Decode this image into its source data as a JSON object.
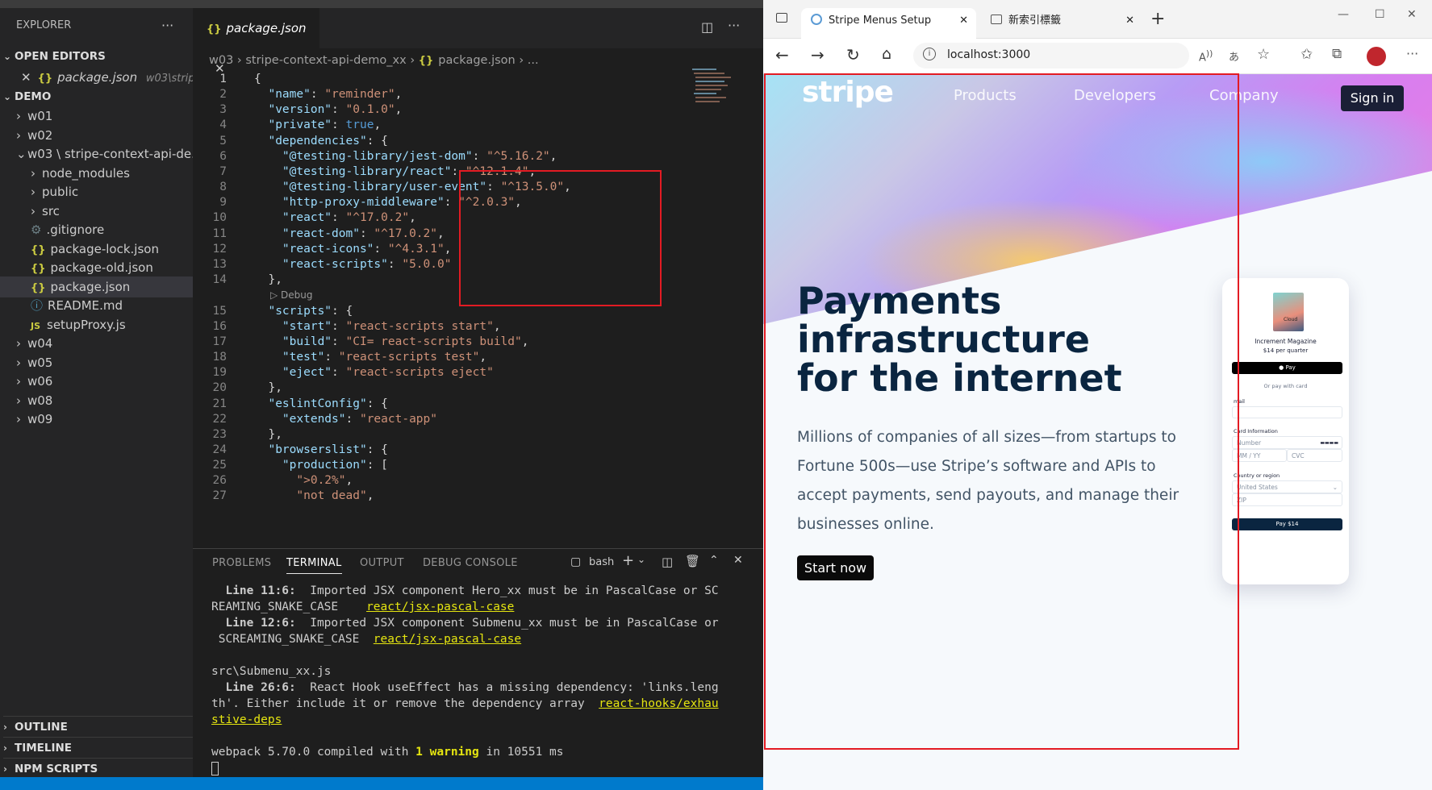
{
  "vscode": {
    "explorer_title": "EXPLORER",
    "open_editors_label": "OPEN EDITORS",
    "open_editor": {
      "name": "package.json",
      "path": "w03\\strip..."
    },
    "workspace_label": "DEMO",
    "tree": [
      {
        "name": "w01",
        "type": "folder"
      },
      {
        "name": "w02",
        "type": "folder"
      },
      {
        "name": "w03 \\ stripe-context-api-de...",
        "type": "folder-open"
      },
      {
        "name": "node_modules",
        "type": "folder",
        "indent": 1
      },
      {
        "name": "public",
        "type": "folder",
        "indent": 1
      },
      {
        "name": "src",
        "type": "folder",
        "indent": 1
      },
      {
        "name": ".gitignore",
        "type": "git",
        "indent": 1
      },
      {
        "name": "package-lock.json",
        "type": "json",
        "indent": 1
      },
      {
        "name": "package-old.json",
        "type": "json",
        "indent": 1
      },
      {
        "name": "package.json",
        "type": "json",
        "indent": 1,
        "selected": true
      },
      {
        "name": "README.md",
        "type": "info",
        "indent": 1
      },
      {
        "name": "setupProxy.js",
        "type": "js",
        "indent": 1
      },
      {
        "name": "w04",
        "type": "folder"
      },
      {
        "name": "w05",
        "type": "folder"
      },
      {
        "name": "w06",
        "type": "folder"
      },
      {
        "name": "w08",
        "type": "folder"
      },
      {
        "name": "w09",
        "type": "folder"
      }
    ],
    "bottom_sections": [
      "OUTLINE",
      "TIMELINE",
      "NPM SCRIPTS"
    ],
    "tab_label": "package.json",
    "breadcrumb": [
      "w03",
      "stripe-context-api-demo_xx",
      "package.json",
      "..."
    ],
    "debug_label": "Debug",
    "code_lines": [
      {
        "n": "1",
        "t": "{"
      },
      {
        "n": "2",
        "t": "  \"name\": \"reminder\","
      },
      {
        "n": "3",
        "t": "  \"version\": \"0.1.0\","
      },
      {
        "n": "4",
        "t": "  \"private\": true,"
      },
      {
        "n": "5",
        "t": "  \"dependencies\": {"
      },
      {
        "n": "6",
        "t": "    \"@testing-library/jest-dom\": \"^5.16.2\","
      },
      {
        "n": "7",
        "t": "    \"@testing-library/react\": \"^12.1.4\","
      },
      {
        "n": "8",
        "t": "    \"@testing-library/user-event\": \"^13.5.0\","
      },
      {
        "n": "9",
        "t": "    \"http-proxy-middleware\": \"^2.0.3\","
      },
      {
        "n": "10",
        "t": "    \"react\": \"^17.0.2\","
      },
      {
        "n": "11",
        "t": "    \"react-dom\": \"^17.0.2\","
      },
      {
        "n": "12",
        "t": "    \"react-icons\": \"^4.3.1\","
      },
      {
        "n": "13",
        "t": "    \"react-scripts\": \"5.0.0\""
      },
      {
        "n": "14",
        "t": "  },"
      },
      {
        "n": "15",
        "t": "  \"scripts\": {"
      },
      {
        "n": "16",
        "t": "    \"start\": \"react-scripts start\","
      },
      {
        "n": "17",
        "t": "    \"build\": \"CI= react-scripts build\","
      },
      {
        "n": "18",
        "t": "    \"test\": \"react-scripts test\","
      },
      {
        "n": "19",
        "t": "    \"eject\": \"react-scripts eject\""
      },
      {
        "n": "20",
        "t": "  },"
      },
      {
        "n": "21",
        "t": "  \"eslintConfig\": {"
      },
      {
        "n": "22",
        "t": "    \"extends\": \"react-app\""
      },
      {
        "n": "23",
        "t": "  },"
      },
      {
        "n": "24",
        "t": "  \"browserslist\": {"
      },
      {
        "n": "25",
        "t": "    \"production\": ["
      },
      {
        "n": "26",
        "t": "      \">0.2%\","
      },
      {
        "n": "27",
        "t": "      \"not dead\","
      }
    ],
    "panel_tabs": [
      "PROBLEMS",
      "TERMINAL",
      "OUTPUT",
      "DEBUG CONSOLE"
    ],
    "terminal_shell": "bash",
    "terminal": {
      "l1_pre": "  Line 11:6:",
      "l1_msg": "  Imported JSX component Hero_xx must be in PascalCase or SC",
      "l1b": "REAMING_SNAKE_CASE",
      "l1_rule": "react/jsx-pascal-case",
      "l2_pre": "  Line 12:6:",
      "l2_msg": "  Imported JSX component Submenu_xx must be in PascalCase or",
      "l2b": " SCREAMING_SNAKE_CASE",
      "l2_rule": "react/jsx-pascal-case",
      "file": "src\\Submenu_xx.js",
      "l3_pre": "  Line 26:6:",
      "l3_msg": "  React Hook useEffect has a missing dependency: 'links.leng",
      "l3b": "th'. Either include it or remove the dependency array",
      "l3_rule1": "react-hooks/exhau",
      "l3_rule2": "stive-deps",
      "compile_a": "webpack 5.70.0 compiled with ",
      "compile_b": "1 warning",
      "compile_c": " in 10551 ms"
    }
  },
  "browser": {
    "tabs": [
      {
        "title": "Stripe Menus Setup",
        "active": true
      },
      {
        "title": "新索引標籤",
        "active": false
      }
    ],
    "url": "localhost:3000",
    "page": {
      "logo": "stripe",
      "nav": [
        "Products",
        "Developers",
        "Company"
      ],
      "sign_in": "Sign in",
      "headline": [
        "Payments",
        "infrastructure",
        "for the internet"
      ],
      "subtext": "Millions of companies of all sizes—from startups to Fortune 500s—use Stripe’s software and APIs to accept payments, send payouts, and manage their businesses online.",
      "cta": "Start now",
      "phone": {
        "product": "Increment Magazine",
        "price": "$14 per quarter",
        "apple_pay": " Pay",
        "or_card": "Or pay with card",
        "email": "mail",
        "card_info": "Card Information",
        "number": "Number",
        "expiry": "MM / YY",
        "cvc": "CVC",
        "country_label": "Country or region",
        "country": "United States",
        "zip": "ZIP",
        "pay": "Pay $14",
        "magazine_word": "Cloud"
      }
    }
  },
  "colors": {
    "accent": "#007acc",
    "stripe_navy": "#0a2540",
    "highlight_red": "#e31b23"
  }
}
